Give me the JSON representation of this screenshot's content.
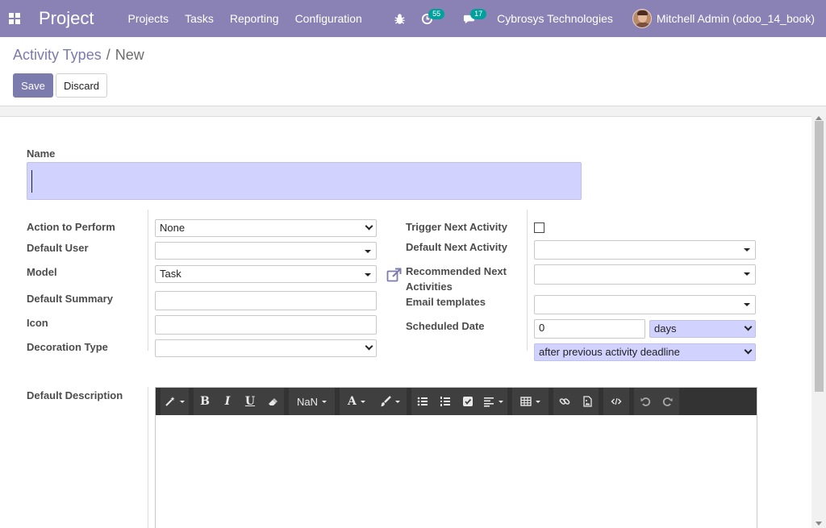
{
  "navbar": {
    "brand": "Project",
    "menu": [
      "Projects",
      "Tasks",
      "Reporting",
      "Configuration"
    ],
    "activity_count": "55",
    "message_count": "17",
    "company": "Cybrosys Technologies",
    "user": "Mitchell Admin (odoo_14_book)",
    "icons": [
      "apps-icon",
      "bug-icon",
      "clock-icon",
      "chat-icon"
    ]
  },
  "breadcrumb": {
    "parent": "Activity Types",
    "separator": "/",
    "current": "New"
  },
  "buttons": {
    "save": "Save",
    "discard": "Discard"
  },
  "form": {
    "name_label": "Name",
    "name_value": "",
    "left": {
      "action_label": "Action to Perform",
      "action_value": "None",
      "default_user_label": "Default User",
      "default_user_value": "",
      "model_label": "Model",
      "model_value": "Task",
      "summary_label": "Default Summary",
      "summary_value": "",
      "icon_label": "Icon",
      "icon_value": "",
      "decoration_label": "Decoration Type",
      "decoration_value": ""
    },
    "right": {
      "trigger_label": "Trigger Next Activity",
      "trigger_checked": false,
      "default_next_label": "Default Next Activity",
      "default_next_value": "",
      "recommended_label_1": "Recommended Next",
      "recommended_label_2": "Activities",
      "recommended_value": "",
      "email_label": "Email templates",
      "email_value": "",
      "scheduled_label": "Scheduled Date",
      "scheduled_value": "0",
      "scheduled_unit": "days",
      "scheduled_from": "after previous activity deadline"
    },
    "description_label": "Default Description"
  },
  "editor_toolbar": {
    "font_size": "NaN",
    "bold": "B",
    "italic": "I",
    "underline": "U",
    "font_color": "A"
  },
  "colors": {
    "navbar": "#8a82b4",
    "primary": "#7c7bad",
    "required_field": "#d2d2ff",
    "badge": "#00a09d"
  }
}
